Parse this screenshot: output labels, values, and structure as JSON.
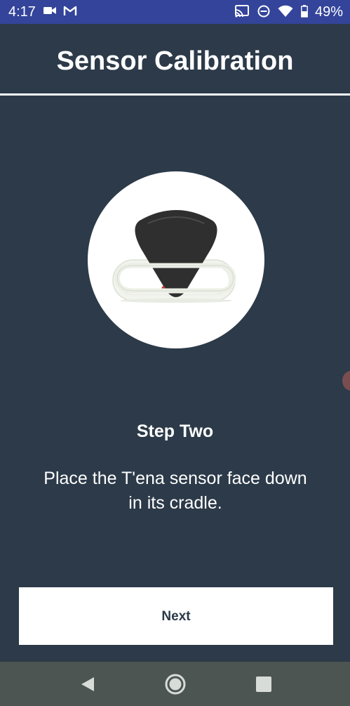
{
  "status_bar": {
    "time": "4:17",
    "battery_percent": "49%",
    "background_color": "#33449A",
    "left_icons": [
      "video-camera-icon",
      "gmail-icon"
    ],
    "right_icons": [
      "cast-icon",
      "do-not-disturb-icon",
      "wifi-icon",
      "battery-icon"
    ]
  },
  "header": {
    "title": "Sensor Calibration"
  },
  "illustration": {
    "icon": "sensor-in-cradle-illustration"
  },
  "step": {
    "title": "Step Two",
    "description": "Place the T'ena sensor face down in its cradle."
  },
  "next_button": {
    "label": "Next"
  },
  "nav_bar": {
    "buttons": [
      "back-icon",
      "home-icon",
      "recents-icon"
    ]
  },
  "colors": {
    "background": "#2C3A49",
    "text": "#FFFFFF",
    "button_background": "#FFFFFF",
    "button_text": "#2C3A49",
    "nav_bar": "#4C5552"
  }
}
